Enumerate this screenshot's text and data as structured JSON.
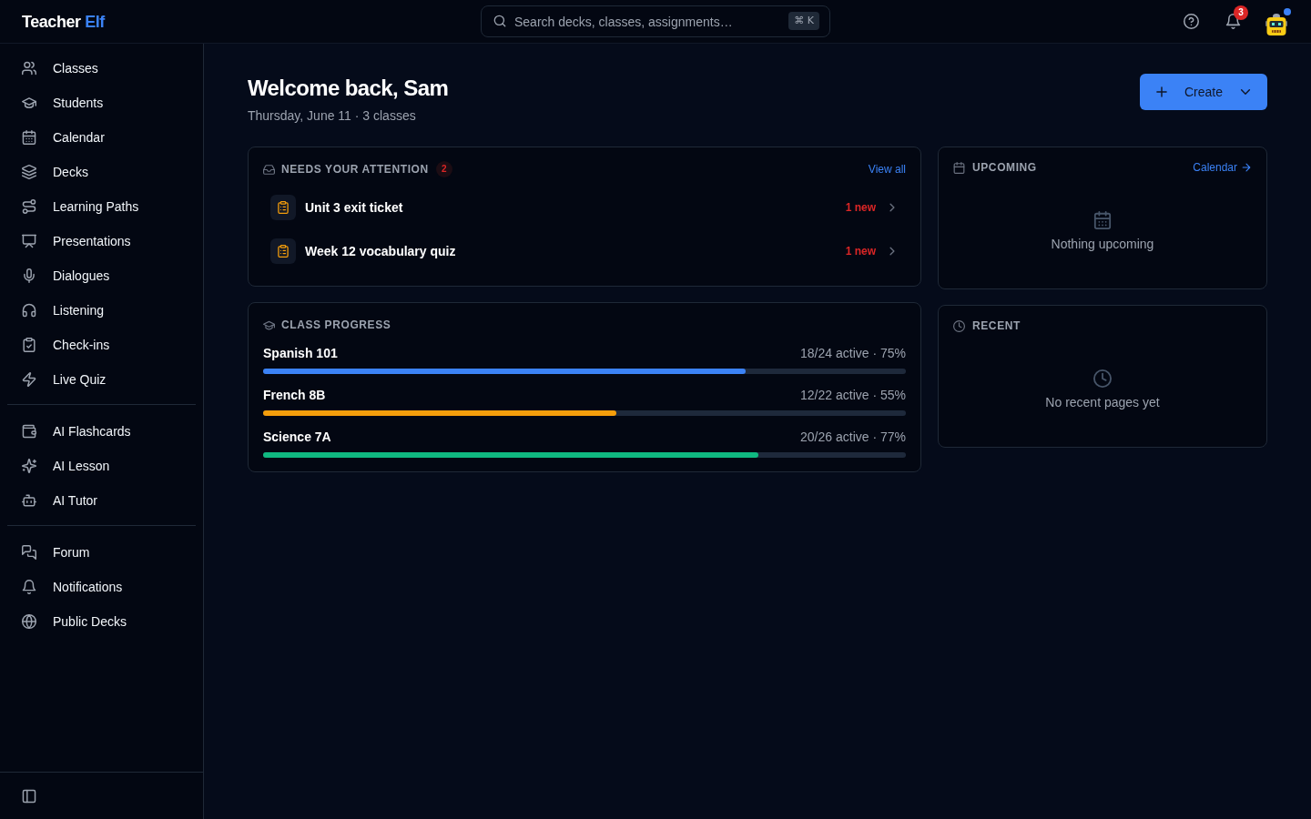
{
  "header": {
    "brand": {
      "name": "Teacher",
      "accent": "Elf"
    },
    "search": {
      "placeholder": "Search decks, classes, assignments…",
      "shortcut": "⌘ K"
    },
    "notifications": {
      "count": "3"
    }
  },
  "sidebar": {
    "groups": [
      {
        "items": [
          {
            "label": "Classes"
          },
          {
            "label": "Students"
          },
          {
            "label": "Calendar"
          },
          {
            "label": "Decks"
          },
          {
            "label": "Learning Paths"
          },
          {
            "label": "Presentations"
          },
          {
            "label": "Dialogues"
          },
          {
            "label": "Listening"
          },
          {
            "label": "Check-ins"
          },
          {
            "label": "Live Quiz"
          }
        ]
      },
      {
        "items": [
          {
            "label": "AI Flashcards"
          },
          {
            "label": "AI Lesson"
          },
          {
            "label": "AI Tutor"
          }
        ]
      },
      {
        "items": [
          {
            "label": "Forum"
          },
          {
            "label": "Notifications"
          },
          {
            "label": "Public Decks"
          }
        ]
      }
    ]
  },
  "page": {
    "title": "Welcome back, Sam",
    "subtitle": "Thursday, June 11 · 3 classes",
    "create_button": {
      "label": "Create"
    }
  },
  "attention": {
    "title": "NEEDS YOUR ATTENTION",
    "count": "2",
    "link": "View all",
    "items": [
      {
        "title": "Unit 3 exit ticket",
        "badge": "1 new"
      },
      {
        "title": "Week 12 vocabulary quiz",
        "badge": "1 new"
      }
    ]
  },
  "progress": {
    "title": "CLASS PROGRESS",
    "classes": [
      {
        "name": "Spanish 101",
        "stats": "18/24 active · 75%",
        "level": 0.75,
        "color": "#3b82f6"
      },
      {
        "name": "French 8B",
        "stats": "12/22 active · 55%",
        "level": 0.55,
        "color": "#f59e0b"
      },
      {
        "name": "Science 7A",
        "stats": "20/26 active · 77%",
        "level": 0.77,
        "color": "#10b981"
      }
    ]
  },
  "upcoming": {
    "title": "UPCOMING",
    "link": "Calendar",
    "empty_text": "Nothing upcoming"
  },
  "recent": {
    "title": "RECENT",
    "empty_text": "No recent pages yet"
  }
}
